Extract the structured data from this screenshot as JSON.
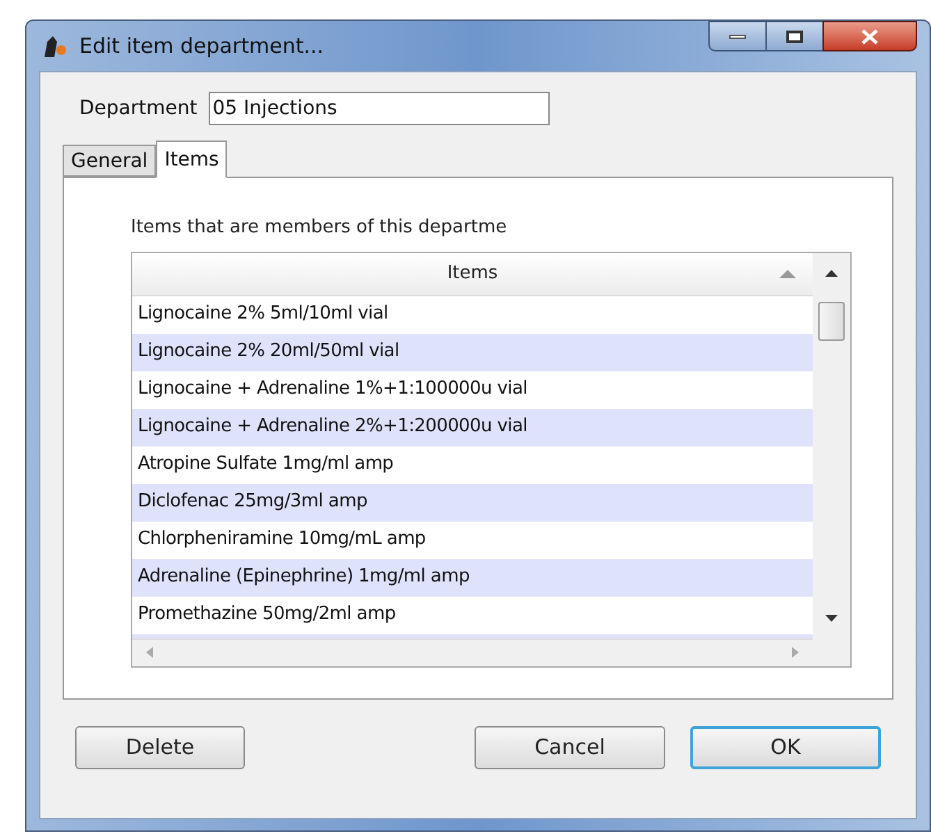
{
  "window": {
    "title": "Edit item department..."
  },
  "department": {
    "label": "Department",
    "value": "05 Injections"
  },
  "tabs": [
    {
      "label": "General",
      "selected": false
    },
    {
      "label": "Items",
      "selected": true
    }
  ],
  "caption": "Items that are members of this departme",
  "table": {
    "columns": [
      "Items"
    ],
    "rows": [
      "Lignocaine 2% 5ml/10ml vial",
      "Lignocaine 2% 20ml/50ml vial",
      "Lignocaine + Adrenaline 1%+1:100000u vial",
      "Lignocaine + Adrenaline 2%+1:200000u vial",
      "Atropine Sulfate 1mg/ml amp",
      "Diclofenac 25mg/3ml amp",
      "Chlorpheniramine 10mg/mL amp",
      "Adrenaline (Epinephrine) 1mg/ml amp",
      "Promethazine 50mg/2ml amp"
    ]
  },
  "buttons": [
    {
      "label": "Delete",
      "default": false
    },
    {
      "label": "Cancel",
      "default": false
    },
    {
      "label": "OK",
      "default": true
    }
  ]
}
